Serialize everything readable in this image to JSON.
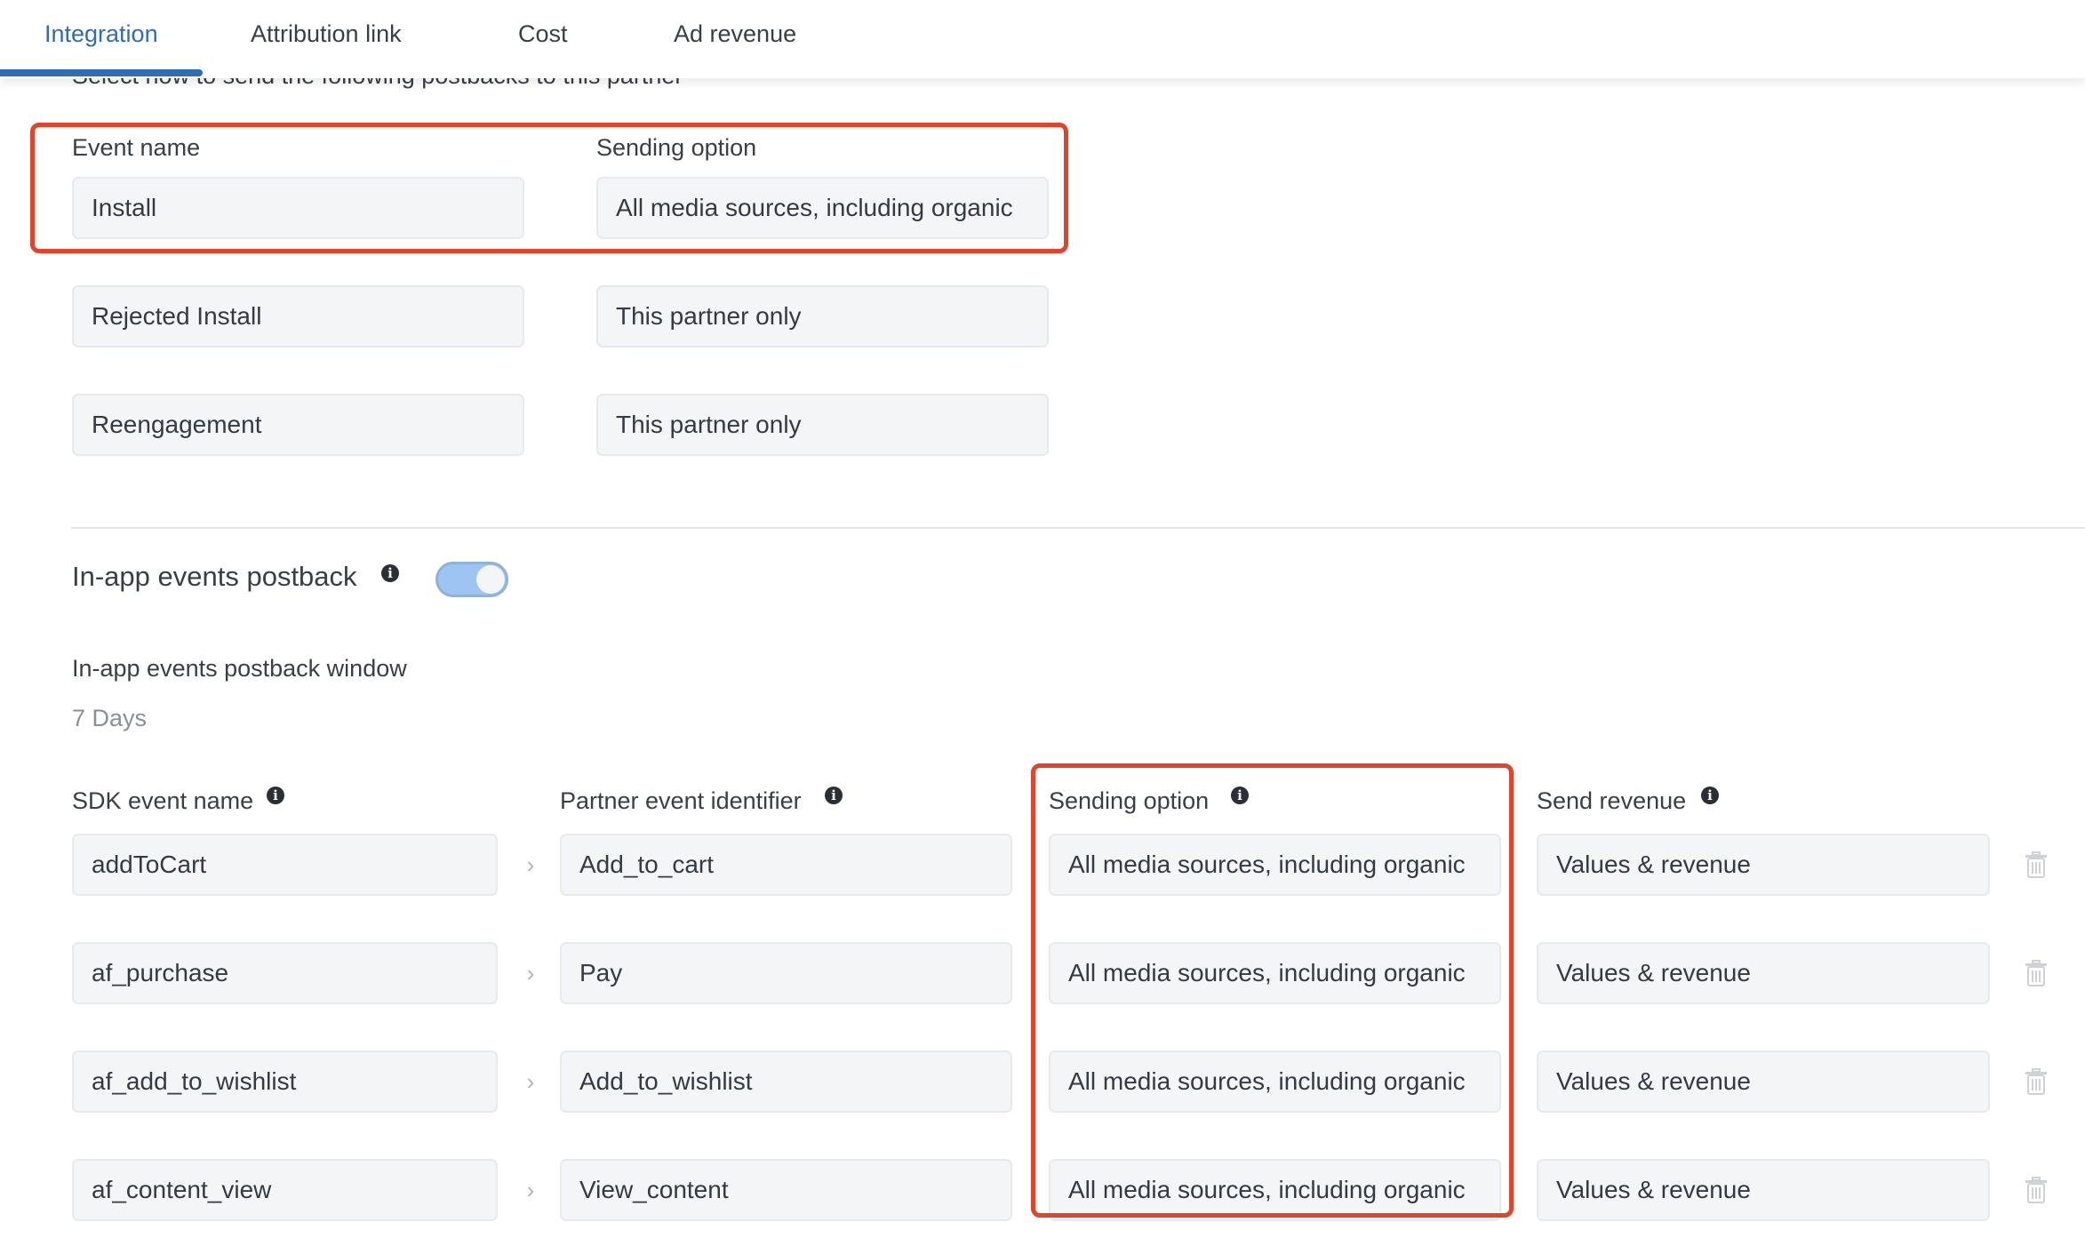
{
  "tabs": [
    {
      "label": "Integration",
      "active": true
    },
    {
      "label": "Attribution link",
      "active": false
    },
    {
      "label": "Cost",
      "active": false
    },
    {
      "label": "Ad revenue",
      "active": false
    }
  ],
  "postbacks": {
    "subtitle": "Select how to send the following postbacks to this partner",
    "event_name_header": "Event name",
    "sending_option_header": "Sending option",
    "rows": [
      {
        "event_name": "Install",
        "sending_option": "All media sources, including organic"
      },
      {
        "event_name": "Rejected Install",
        "sending_option": "This partner only"
      },
      {
        "event_name": "Reengagement",
        "sending_option": "This partner only"
      }
    ]
  },
  "in_app": {
    "title": "In-app events postback",
    "toggle_on": true,
    "window_label": "In-app events postback window",
    "window_value": "7 Days",
    "headers": {
      "sdk_event_name": "SDK event name",
      "partner_event_identifier": "Partner event identifier",
      "sending_option": "Sending option",
      "send_revenue": "Send revenue"
    },
    "rows": [
      {
        "sdk_event": "addToCart",
        "partner_event": "Add_to_cart",
        "sending_option": "All media sources, including organic",
        "send_revenue": "Values & revenue"
      },
      {
        "sdk_event": "af_purchase",
        "partner_event": "Pay",
        "sending_option": "All media sources, including organic",
        "send_revenue": "Values & revenue"
      },
      {
        "sdk_event": "af_add_to_wishlist",
        "partner_event": "Add_to_wishlist",
        "sending_option": "All media sources, including organic",
        "send_revenue": "Values & revenue"
      },
      {
        "sdk_event": "af_content_view",
        "partner_event": "View_content",
        "sending_option": "All media sources, including organic",
        "send_revenue": "Values & revenue"
      }
    ]
  },
  "icons": {
    "info": "i",
    "chevron": "›"
  },
  "colors": {
    "accent": "#2f6db5",
    "highlight": "#e2432b",
    "toggle_track": "#9dc4f2"
  }
}
